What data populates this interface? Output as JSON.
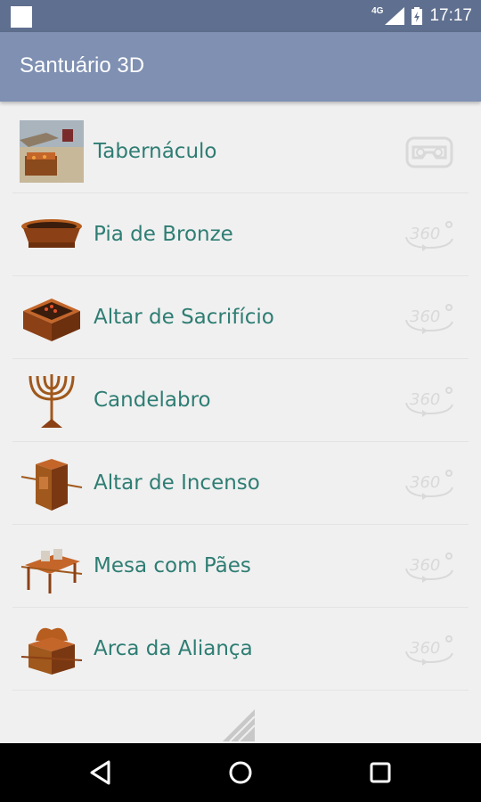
{
  "status_bar": {
    "network": "4G",
    "time": "17:17"
  },
  "app_bar": {
    "title": "Santuário 3D"
  },
  "items": [
    {
      "label": "Tabernáculo",
      "thumb_icon": "tabernacle-icon",
      "action_icon": "vr-headset-icon"
    },
    {
      "label": "Pia de Bronze",
      "thumb_icon": "bronze-basin-icon",
      "action_icon": "360-view-icon"
    },
    {
      "label": "Altar de Sacrifício",
      "thumb_icon": "sacrifice-altar-icon",
      "action_icon": "360-view-icon"
    },
    {
      "label": "Candelabro",
      "thumb_icon": "candelabra-icon",
      "action_icon": "360-view-icon"
    },
    {
      "label": "Altar de Incenso",
      "thumb_icon": "incense-altar-icon",
      "action_icon": "360-view-icon"
    },
    {
      "label": "Mesa com Pães",
      "thumb_icon": "bread-table-icon",
      "action_icon": "360-view-icon"
    },
    {
      "label": "Arca da Aliança",
      "thumb_icon": "ark-covenant-icon",
      "action_icon": "360-view-icon"
    }
  ],
  "colors": {
    "status_bar": "#5f6f8f",
    "app_bar": "#7f90b2",
    "item_text": "#2e7d73",
    "background": "#f0f0f0"
  }
}
